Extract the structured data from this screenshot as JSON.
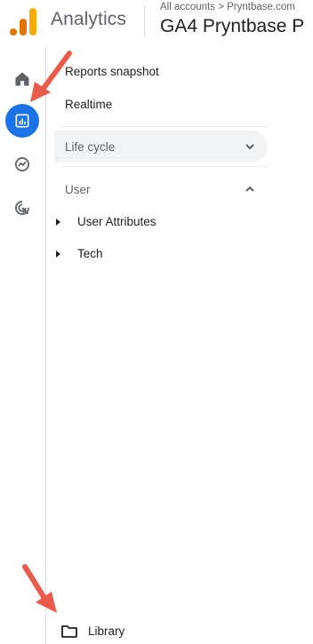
{
  "header": {
    "app_title": "Analytics",
    "account_path": "All accounts > Pryntbase.com",
    "property_name": "GA4 Pryntbase P"
  },
  "rail": {
    "items": [
      {
        "icon": "home-icon"
      },
      {
        "icon": "reports-bar-chart-icon",
        "active": true
      },
      {
        "icon": "explore-icon"
      },
      {
        "icon": "advertising-icon"
      }
    ]
  },
  "nav": {
    "reports_snapshot": "Reports snapshot",
    "realtime": "Realtime",
    "lifecycle": "Life cycle",
    "user": "User",
    "user_attributes": "User Attributes",
    "tech": "Tech",
    "library": "Library"
  },
  "colors": {
    "accent": "#1a73e8",
    "annotation_arrow": "#ea5b4a",
    "logo_orange": "#f9ab00",
    "logo_dark_orange": "#e37400"
  }
}
